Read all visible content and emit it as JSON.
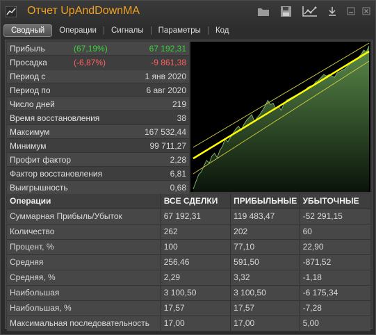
{
  "window": {
    "title": "Отчет UpAndDownMA"
  },
  "tabs": [
    {
      "label": "Сводный",
      "active": true
    },
    {
      "label": "Операции",
      "active": false
    },
    {
      "label": "Сигналы",
      "active": false
    },
    {
      "label": "Параметры",
      "active": false
    },
    {
      "label": "Код",
      "active": false
    }
  ],
  "stats": [
    {
      "label": "Прибыль",
      "pct": "(67,19%)",
      "pct_color": "green",
      "value": "67 192,31",
      "value_color": "green"
    },
    {
      "label": "Просадка",
      "pct": "(-6,87%)",
      "pct_color": "red",
      "value": "-9 861,38",
      "value_color": "red"
    },
    {
      "label": "Период с",
      "value": "1 янв 2020"
    },
    {
      "label": "Период по",
      "value": "6 авг 2020"
    },
    {
      "label": "Число дней",
      "value": "219"
    },
    {
      "label": "Время восстановления",
      "value": "38"
    },
    {
      "label": "Максимум",
      "value": "167 532,44"
    },
    {
      "label": "Минимум",
      "value": "99 711,27"
    },
    {
      "label": "Профит фактор",
      "value": "2,28"
    },
    {
      "label": "Фактор восстановления",
      "value": "6,81"
    },
    {
      "label": "Выигрышность",
      "value": "0,68"
    }
  ],
  "table": {
    "headers": [
      "Операции",
      "ВСЕ СДЕЛКИ",
      "ПРИБЫЛЬНЫЕ",
      "УБЫТОЧНЫЕ"
    ],
    "rows": [
      [
        "Суммарная Прибыль/Убыток",
        "67 192,31",
        "119 483,47",
        "-52 291,15"
      ],
      [
        "Количество",
        "262",
        "202",
        "60"
      ],
      [
        "Процент, %",
        "100",
        "77,10",
        "22,90"
      ],
      [
        "Средняя",
        "256,46",
        "591,50",
        "-871,52"
      ],
      [
        "Средняя, %",
        "2,29",
        "3,32",
        "-1,18"
      ],
      [
        "Наибольшая",
        "3 100,50",
        "3 100,50",
        "-6 175,34"
      ],
      [
        "Наибольшая, %",
        "17,57",
        "17,57",
        "-7,28"
      ],
      [
        "Максимальная последовательность",
        "17,00",
        "17,00",
        "5,00"
      ]
    ]
  },
  "equity_chart": {
    "type": "area",
    "values": [
      0.0,
      0.05,
      0.1,
      0.12,
      0.16,
      0.2,
      0.18,
      0.23,
      0.25,
      0.22,
      0.27,
      0.3,
      0.35,
      0.33,
      0.36,
      0.39,
      0.42,
      0.44,
      0.41,
      0.45,
      0.48,
      0.5,
      0.52,
      0.47,
      0.5,
      0.52,
      0.55,
      0.58,
      0.62,
      0.59,
      0.6,
      0.56,
      0.58,
      0.55,
      0.59,
      0.62,
      0.63,
      0.64,
      0.65,
      0.66,
      0.67,
      0.68,
      0.69,
      0.71,
      0.72,
      0.72,
      0.75,
      0.76,
      0.78,
      0.8,
      0.79,
      0.8,
      0.79,
      0.78,
      0.81,
      0.82,
      0.83,
      0.84,
      0.86,
      0.88,
      0.89,
      0.9,
      0.92,
      0.94,
      0.97,
      0.96,
      1.0
    ],
    "colors": {
      "area_top": "#5a8a4a",
      "line": "#ffff00",
      "band": "#c8c840"
    }
  }
}
